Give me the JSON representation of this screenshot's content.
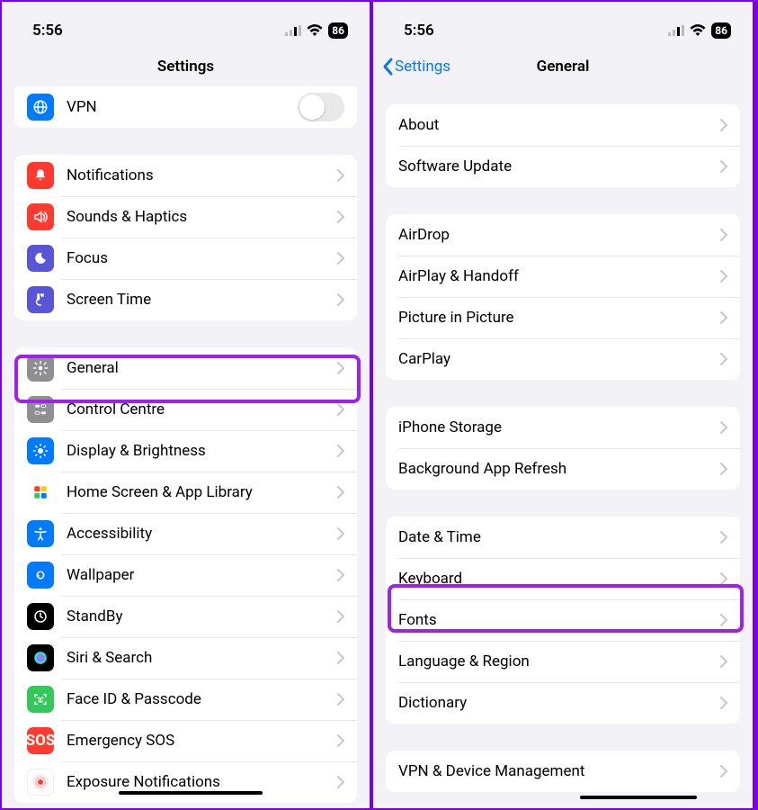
{
  "left": {
    "status": {
      "time": "5:56",
      "battery": "86"
    },
    "title": "Settings",
    "group_vpn": {
      "label": "VPN"
    },
    "group_a": [
      {
        "key": "notifications",
        "label": "Notifications",
        "color": "ic-red"
      },
      {
        "key": "sounds",
        "label": "Sounds & Haptics",
        "color": "ic-red"
      },
      {
        "key": "focus",
        "label": "Focus",
        "color": "ic-purple"
      },
      {
        "key": "screentime",
        "label": "Screen Time",
        "color": "ic-purple"
      }
    ],
    "group_b": [
      {
        "key": "general",
        "label": "General",
        "color": "ic-gray"
      },
      {
        "key": "controlcentre",
        "label": "Control Centre",
        "color": "ic-gray"
      },
      {
        "key": "display",
        "label": "Display & Brightness",
        "color": "ic-blue"
      },
      {
        "key": "homescreen",
        "label": "Home Screen & App Library",
        "color": "ic-multi"
      },
      {
        "key": "accessibility",
        "label": "Accessibility",
        "color": "ic-blue"
      },
      {
        "key": "wallpaper",
        "label": "Wallpaper",
        "color": "ic-blue"
      },
      {
        "key": "standby",
        "label": "StandBy",
        "color": "ic-black"
      },
      {
        "key": "siri",
        "label": "Siri & Search",
        "color": "ic-black"
      },
      {
        "key": "faceid",
        "label": "Face ID & Passcode",
        "color": "ic-green"
      },
      {
        "key": "sos",
        "label": "Emergency SOS",
        "color": "ic-sos",
        "text": "SOS"
      },
      {
        "key": "exposure",
        "label": "Exposure Notifications",
        "color": "ic-white"
      }
    ]
  },
  "right": {
    "status": {
      "time": "5:56",
      "battery": "86"
    },
    "back": "Settings",
    "title": "General",
    "group_a": [
      {
        "key": "about",
        "label": "About"
      },
      {
        "key": "software",
        "label": "Software Update"
      }
    ],
    "group_b": [
      {
        "key": "airdrop",
        "label": "AirDrop"
      },
      {
        "key": "airplay",
        "label": "AirPlay & Handoff"
      },
      {
        "key": "pip",
        "label": "Picture in Picture"
      },
      {
        "key": "carplay",
        "label": "CarPlay"
      }
    ],
    "group_c": [
      {
        "key": "storage",
        "label": "iPhone Storage"
      },
      {
        "key": "refresh",
        "label": "Background App Refresh"
      }
    ],
    "group_d": [
      {
        "key": "datetime",
        "label": "Date & Time"
      },
      {
        "key": "keyboard",
        "label": "Keyboard"
      },
      {
        "key": "fonts",
        "label": "Fonts"
      },
      {
        "key": "lang",
        "label": "Language & Region"
      },
      {
        "key": "dict",
        "label": "Dictionary"
      }
    ],
    "group_e": [
      {
        "key": "vpndm",
        "label": "VPN & Device Management"
      }
    ]
  }
}
